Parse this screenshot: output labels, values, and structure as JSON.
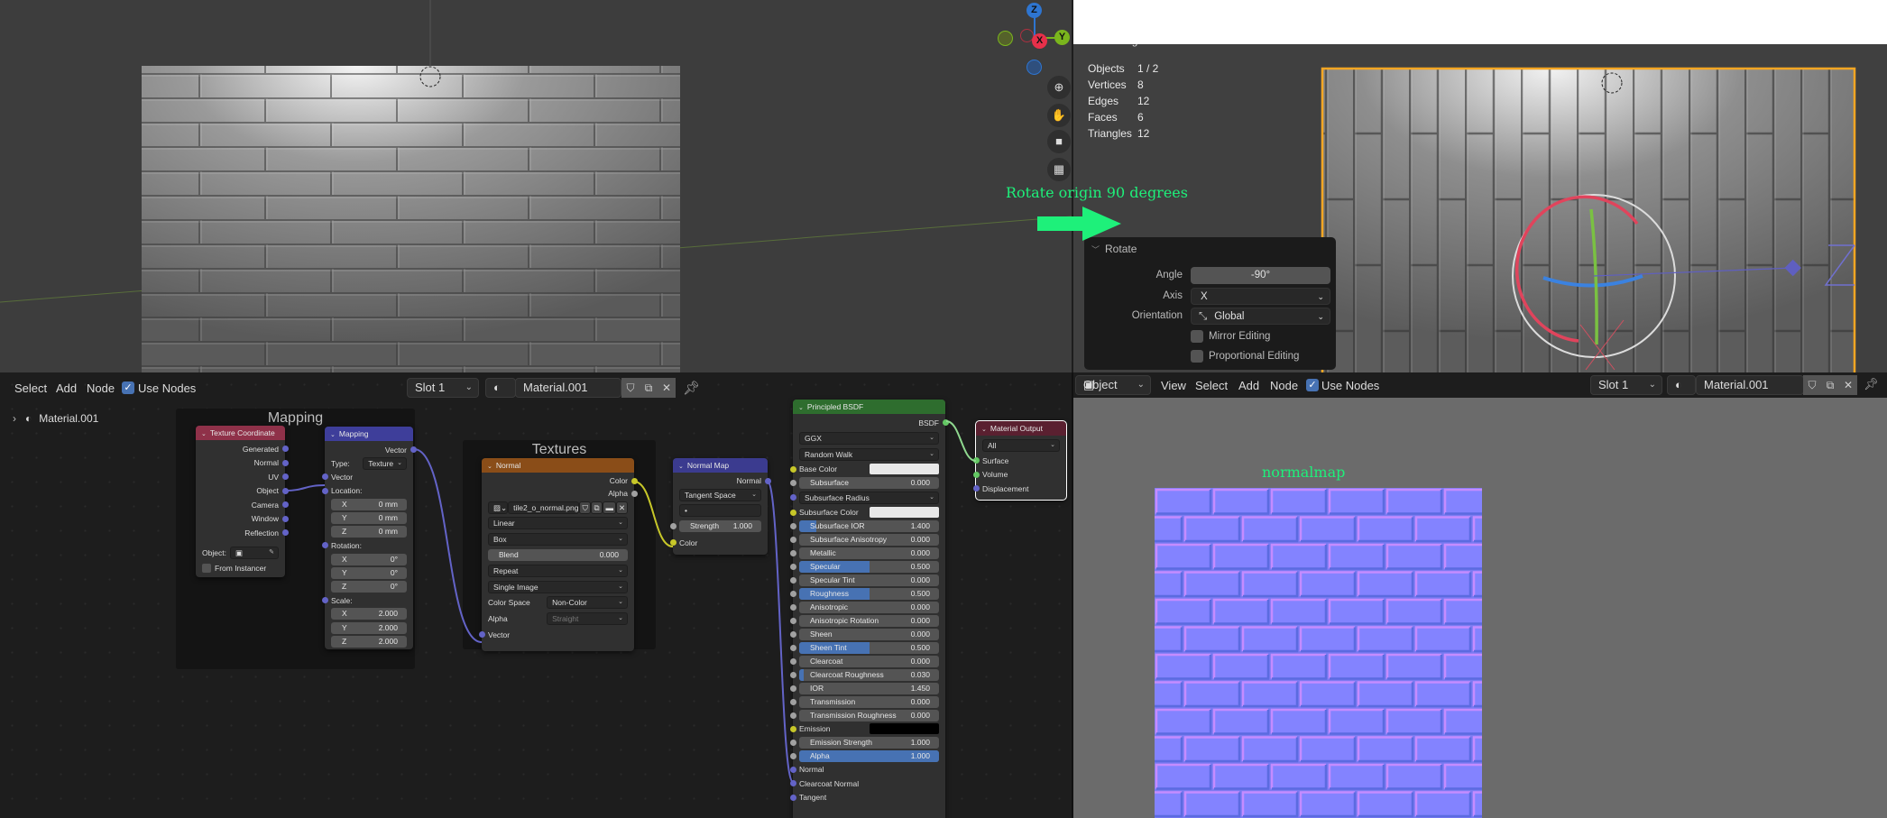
{
  "viewport_left": {
    "nav_buttons": [
      "zoom-icon",
      "hand-pan-icon",
      "camera-icon",
      "grid-ortho-icon"
    ],
    "gizmo": {
      "z": "Z",
      "x": "X",
      "y": "Y"
    }
  },
  "viewport_right": {
    "status_title": "Rendering Done",
    "stats": [
      {
        "label": "Objects",
        "value": "1 / 2"
      },
      {
        "label": "Vertices",
        "value": "8"
      },
      {
        "label": "Edges",
        "value": "12"
      },
      {
        "label": "Faces",
        "value": "6"
      },
      {
        "label": "Triangles",
        "value": "12"
      }
    ],
    "annotation": "Rotate origin 90 degrees",
    "annotation_color": "#1ef07a",
    "selection_color": "#f5a623",
    "rotate_panel": {
      "title": "Rotate",
      "angle_label": "Angle",
      "angle_value": "-90°",
      "axis_label": "Axis",
      "axis_value": "X",
      "orientation_label": "Orientation",
      "orientation_value": "Global",
      "mirror_label": "Mirror Editing",
      "proportional_label": "Proportional Editing"
    }
  },
  "node_editor": {
    "header": {
      "select": "Select",
      "add": "Add",
      "node": "Node",
      "use_nodes": "Use Nodes",
      "slot": "Slot 1",
      "material": "Material.001"
    },
    "outliner_item": "Material.001",
    "frames": {
      "mapping": "Mapping",
      "textures": "Textures"
    },
    "socket_colors": {
      "vector": "#6363c7",
      "color": "#c7c729",
      "float": "#a1a1a1",
      "shader": "#63c763"
    },
    "nodes": {
      "texcoord": {
        "title": "Texture Coordinate",
        "color": "#8f3149",
        "rows": [
          {
            "t": "out",
            "label": "Generated",
            "sock": "vector"
          },
          {
            "t": "out",
            "label": "Normal",
            "sock": "vector"
          },
          {
            "t": "out",
            "label": "UV",
            "sock": "vector"
          },
          {
            "t": "out",
            "label": "Object",
            "sock": "vector"
          },
          {
            "t": "out",
            "label": "Camera",
            "sock": "vector"
          },
          {
            "t": "out",
            "label": "Window",
            "sock": "vector"
          },
          {
            "t": "out",
            "label": "Reflection",
            "sock": "vector"
          },
          {
            "t": "obj",
            "label": "Object:"
          },
          {
            "t": "check",
            "label": "From Instancer"
          }
        ]
      },
      "mapping": {
        "title": "Mapping",
        "color": "#3e3e9a",
        "rows": [
          {
            "t": "out",
            "label": "Vector",
            "sock": "vector"
          },
          {
            "t": "sel",
            "label": "Type:",
            "value": "Texture"
          },
          {
            "t": "in",
            "label": "Vector",
            "sock": "vector"
          },
          {
            "t": "in",
            "label": "Location:",
            "sock": "vector"
          },
          {
            "t": "field",
            "label": "X",
            "value": "0 mm"
          },
          {
            "t": "field",
            "label": "Y",
            "value": "0 mm"
          },
          {
            "t": "field",
            "label": "Z",
            "value": "0 mm"
          },
          {
            "t": "in",
            "label": "Rotation:",
            "sock": "vector"
          },
          {
            "t": "field",
            "label": "X",
            "value": "0°"
          },
          {
            "t": "field",
            "label": "Y",
            "value": "0°"
          },
          {
            "t": "field",
            "label": "Z",
            "value": "0°"
          },
          {
            "t": "in",
            "label": "Scale:",
            "sock": "vector"
          },
          {
            "t": "field",
            "label": "X",
            "value": "2.000"
          },
          {
            "t": "field",
            "label": "Y",
            "value": "2.000"
          },
          {
            "t": "field",
            "label": "Z",
            "value": "2.000"
          }
        ]
      },
      "image": {
        "title": "Normal",
        "color": "#8a4d18",
        "rows": [
          {
            "t": "out",
            "label": "Color",
            "sock": "color"
          },
          {
            "t": "out",
            "label": "Alpha",
            "sock": "float"
          },
          {
            "t": "img",
            "value": "tile2_o_normal.png"
          },
          {
            "t": "sel",
            "value": "Linear"
          },
          {
            "t": "sel",
            "value": "Box"
          },
          {
            "t": "field",
            "label": "Blend",
            "value": "0.000"
          },
          {
            "t": "sel",
            "value": "Repeat"
          },
          {
            "t": "sel",
            "value": "Single Image"
          },
          {
            "t": "sel",
            "label": "Color Space",
            "value": "Non-Color"
          },
          {
            "t": "sel",
            "label": "Alpha",
            "value": "Straight",
            "disabled": true
          },
          {
            "t": "in",
            "label": "Vector",
            "sock": "vector"
          }
        ]
      },
      "normalmap": {
        "title": "Normal Map",
        "color": "#3b3b8f",
        "rows": [
          {
            "t": "out",
            "label": "Normal",
            "sock": "vector"
          },
          {
            "t": "sel",
            "value": "Tangent Space"
          },
          {
            "t": "sel",
            "value": "•",
            "nochev": true
          },
          {
            "t": "slider",
            "label": "Strength",
            "value": "1.000",
            "fill": 0,
            "sock": "float"
          },
          {
            "t": "in",
            "label": "Color",
            "sock": "color"
          }
        ]
      },
      "bsdf": {
        "title": "Principled BSDF",
        "color": "#2e6d2e",
        "rows": [
          {
            "t": "out",
            "label": "BSDF",
            "sock": "shader"
          },
          {
            "t": "sel",
            "value": "GGX"
          },
          {
            "t": "sel",
            "value": "Random Walk"
          },
          {
            "t": "color",
            "label": "Base Color",
            "swatch": "#e8e8e8",
            "sock": "color"
          },
          {
            "t": "slider",
            "label": "Subsurface",
            "value": "0.000",
            "fill": 0,
            "sock": "float"
          },
          {
            "t": "sel",
            "value": "Subsurface Radius",
            "sock": "vector"
          },
          {
            "t": "color",
            "label": "Subsurface Color",
            "swatch": "#e8e8e8",
            "sock": "color"
          },
          {
            "t": "slider",
            "label": "Subsurface IOR",
            "value": "1.400",
            "fill": 0.12,
            "sock": "float"
          },
          {
            "t": "slider",
            "label": "Subsurface Anisotropy",
            "value": "0.000",
            "fill": 0,
            "sock": "float"
          },
          {
            "t": "slider",
            "label": "Metallic",
            "value": "0.000",
            "fill": 0,
            "sock": "float"
          },
          {
            "t": "slider",
            "label": "Specular",
            "value": "0.500",
            "fill": 0.5,
            "sock": "float"
          },
          {
            "t": "slider",
            "label": "Specular Tint",
            "value": "0.000",
            "fill": 0,
            "sock": "float"
          },
          {
            "t": "slider",
            "label": "Roughness",
            "value": "0.500",
            "fill": 0.5,
            "sock": "float"
          },
          {
            "t": "slider",
            "label": "Anisotropic",
            "value": "0.000",
            "fill": 0,
            "sock": "float"
          },
          {
            "t": "slider",
            "label": "Anisotropic Rotation",
            "value": "0.000",
            "fill": 0,
            "sock": "float"
          },
          {
            "t": "slider",
            "label": "Sheen",
            "value": "0.000",
            "fill": 0,
            "sock": "float"
          },
          {
            "t": "slider",
            "label": "Sheen Tint",
            "value": "0.500",
            "fill": 0.5,
            "sock": "float"
          },
          {
            "t": "slider",
            "label": "Clearcoat",
            "value": "0.000",
            "fill": 0,
            "sock": "float"
          },
          {
            "t": "slider",
            "label": "Clearcoat Roughness",
            "value": "0.030",
            "fill": 0.03,
            "sock": "float"
          },
          {
            "t": "slider",
            "label": "IOR",
            "value": "1.450",
            "fill": 0,
            "sock": "float"
          },
          {
            "t": "slider",
            "label": "Transmission",
            "value": "0.000",
            "fill": 0,
            "sock": "float"
          },
          {
            "t": "slider",
            "label": "Transmission Roughness",
            "value": "0.000",
            "fill": 0,
            "sock": "float"
          },
          {
            "t": "color",
            "label": "Emission",
            "swatch": "#000000",
            "sock": "color"
          },
          {
            "t": "slider",
            "label": "Emission Strength",
            "value": "1.000",
            "fill": 0,
            "sock": "float"
          },
          {
            "t": "slider",
            "label": "Alpha",
            "value": "1.000",
            "fill": 1,
            "sock": "float"
          },
          {
            "t": "in",
            "label": "Normal",
            "sock": "vector"
          },
          {
            "t": "in",
            "label": "Clearcoat Normal",
            "sock": "vector"
          },
          {
            "t": "in",
            "label": "Tangent",
            "sock": "vector"
          }
        ]
      },
      "output": {
        "title": "Material Output",
        "color": "#5a2030",
        "rows": [
          {
            "t": "sel",
            "value": "All"
          },
          {
            "t": "in",
            "label": "Surface",
            "sock": "shader"
          },
          {
            "t": "in",
            "label": "Volume",
            "sock": "shader"
          },
          {
            "t": "in",
            "label": "Displacement",
            "sock": "vector"
          }
        ]
      }
    }
  },
  "image_editor": {
    "header": {
      "mode": "Object",
      "view": "View",
      "select": "Select",
      "add": "Add",
      "node": "Node",
      "use_nodes": "Use Nodes",
      "slot": "Slot 1",
      "material": "Material.001"
    },
    "caption": "normalmap",
    "caption_color": "#1ef07a"
  }
}
